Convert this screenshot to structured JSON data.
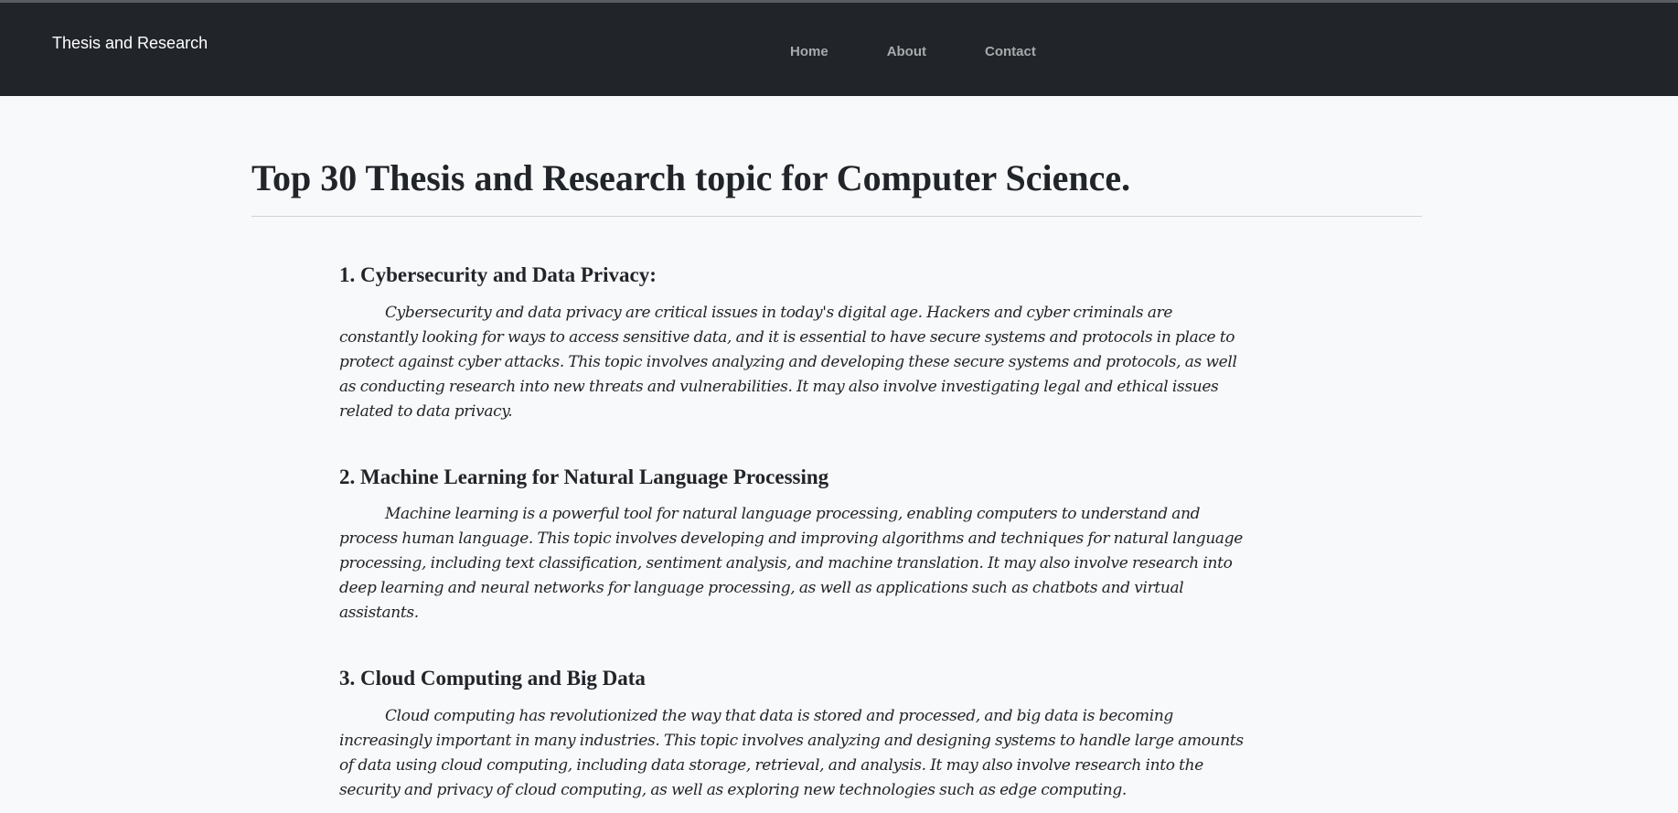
{
  "navbar": {
    "brand": "Thesis and Research",
    "links": [
      {
        "label": "Home"
      },
      {
        "label": "About"
      },
      {
        "label": "Contact"
      }
    ]
  },
  "main": {
    "title": "Top 30 Thesis and Research topic for Computer Science.",
    "topics": [
      {
        "heading": "1. Cybersecurity and Data Privacy:",
        "body": "Cybersecurity and data privacy are critical issues in today's digital age. Hackers and cyber criminals are constantly looking for ways to access sensitive data, and it is essential to have secure systems and protocols in place to protect against cyber attacks. This topic involves analyzing and developing these secure systems and protocols, as well as conducting research into new threats and vulnerabilities. It may also involve investigating legal and ethical issues related to data privacy."
      },
      {
        "heading": "2. Machine Learning for Natural Language Processing",
        "body": "Machine learning is a powerful tool for natural language processing, enabling computers to understand and process human language. This topic involves developing and improving algorithms and techniques for natural language processing, including text classification, sentiment analysis, and machine translation. It may also involve research into deep learning and neural networks for language processing, as well as applications such as chatbots and virtual assistants."
      },
      {
        "heading": "3. Cloud Computing and Big Data",
        "body": "Cloud computing has revolutionized the way that data is stored and processed, and big data is becoming increasingly important in many industries. This topic involves analyzing and designing systems to handle large amounts of data using cloud computing, including data storage, retrieval, and analysis. It may also involve research into the security and privacy of cloud computing, as well as exploring new technologies such as edge computing."
      }
    ]
  }
}
